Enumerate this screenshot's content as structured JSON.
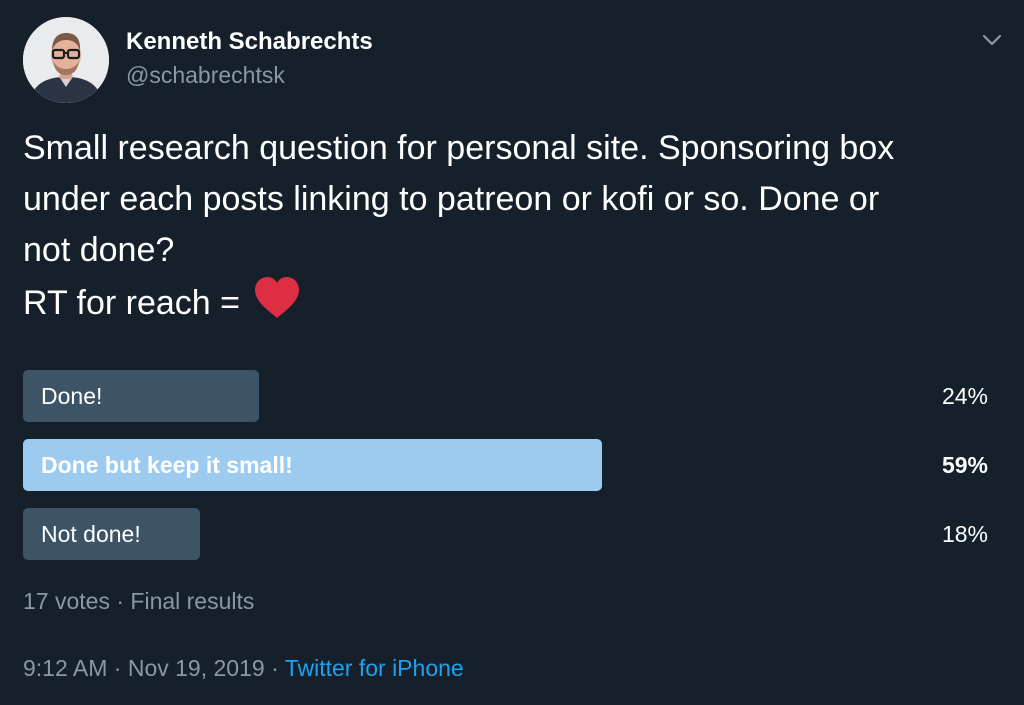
{
  "author": {
    "name": "Kenneth Schabrechts",
    "handle": "@schabrechtsk",
    "avatar_icon": "profile-photo"
  },
  "menu_icon": "chevron-down-icon",
  "tweet": {
    "lines": [
      "Small research question for personal site. Sponsoring box",
      "under each posts linking to patreon or kofi or so. Done or",
      "not done?",
      "RT for reach ="
    ],
    "emoji": "red-heart",
    "emoji_color": "#dd2e44"
  },
  "poll": {
    "options": [
      {
        "label": "Done!",
        "percent_text": "24%",
        "percent": 24,
        "winner": false
      },
      {
        "label": "Done but keep it small!",
        "percent_text": "59%",
        "percent": 59,
        "winner": true
      },
      {
        "label": "Not done!",
        "percent_text": "18%",
        "percent": 18,
        "winner": false
      }
    ],
    "votes": "17 votes",
    "separator": "·",
    "status": "Final results",
    "bar_color": "#3d5466",
    "winner_color": "#9dcbef"
  },
  "meta": {
    "time": "9:12 AM",
    "date": "Nov 19, 2019",
    "separator": "·",
    "source": "Twitter for iPhone",
    "source_color": "#1da1f2"
  },
  "colors": {
    "background": "#15202b",
    "text": "#ffffff",
    "muted": "#8899a6"
  }
}
